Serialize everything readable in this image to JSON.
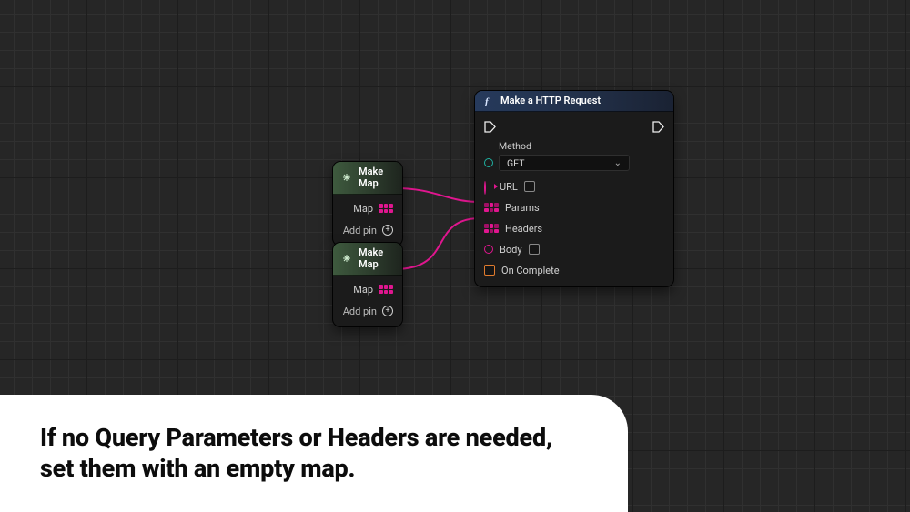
{
  "node_makemap1": {
    "title": "Make Map",
    "output_label": "Map",
    "addpin_label": "Add pin"
  },
  "node_makemap2": {
    "title": "Make Map",
    "output_label": "Map",
    "addpin_label": "Add pin"
  },
  "node_http": {
    "title": "Make a HTTP Request",
    "method_label": "Method",
    "method_value": "GET",
    "url_label": "URL",
    "params_label": "Params",
    "headers_label": "Headers",
    "body_label": "Body",
    "oncomplete_label": "On Complete"
  },
  "caption_text": "If no Query Parameters or Headers are needed, set them with an empty map."
}
